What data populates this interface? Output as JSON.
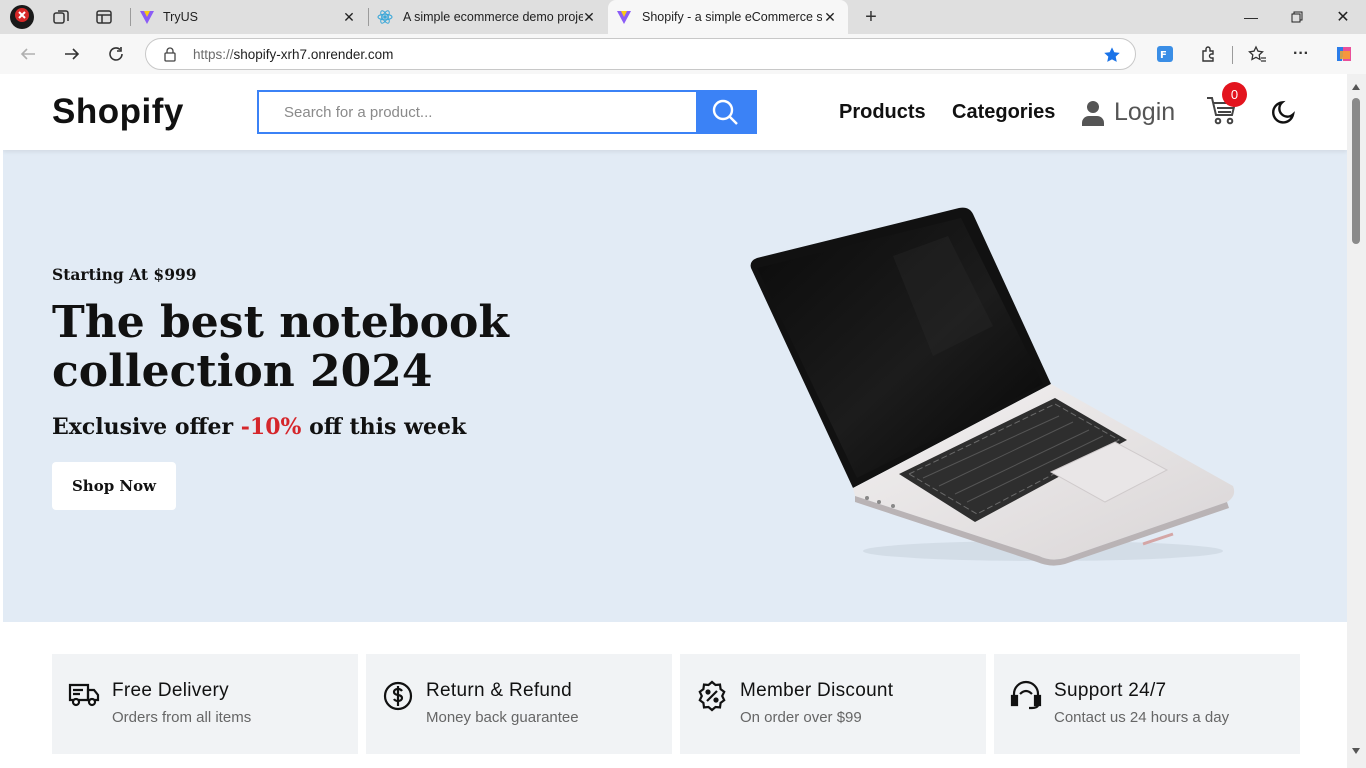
{
  "browser": {
    "tabs": [
      {
        "title": "TryUS"
      },
      {
        "title": "A simple ecommerce demo proje"
      },
      {
        "title": "Shopify - a simple eCommerce sit"
      }
    ],
    "url_protocol": "https://",
    "url_host": "shopify-xrh7.onrender.com"
  },
  "header": {
    "logo": "Shopify",
    "search_placeholder": "Search for a product...",
    "nav": {
      "products": "Products",
      "categories": "Categories",
      "login": "Login"
    },
    "cart_count": "0"
  },
  "hero": {
    "subtitle": "Starting At $999",
    "title": "The best notebook collection 2024",
    "offer_prefix": "Exclusive offer ",
    "offer_percent": "-10%",
    "offer_suffix": " off this week",
    "button": "Shop Now"
  },
  "features": [
    {
      "icon": "truck-icon",
      "title": "Free Delivery",
      "desc": "Orders from all items"
    },
    {
      "icon": "dollar-icon",
      "title": "Return & Refund",
      "desc": "Money back guarantee"
    },
    {
      "icon": "discount-icon",
      "title": "Member Discount",
      "desc": "On order over $99"
    },
    {
      "icon": "headset-icon",
      "title": "Support 24/7",
      "desc": "Contact us 24 hours a day"
    }
  ],
  "colors": {
    "accent": "#3b82f6",
    "badge": "#e3141e",
    "hero_bg": "#e2ebf5",
    "offer": "#d5262b"
  }
}
